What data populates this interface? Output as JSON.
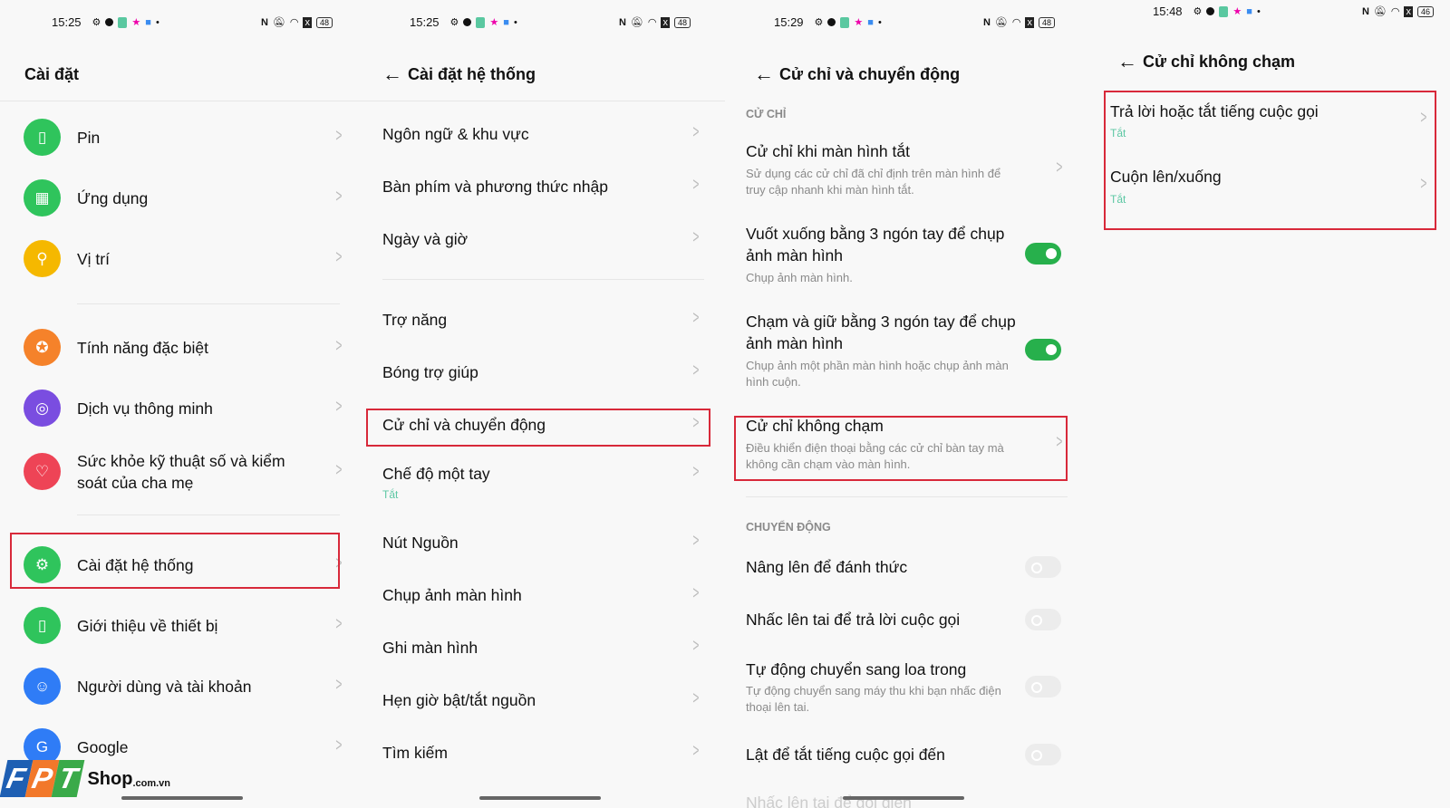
{
  "panels": [
    {
      "status": {
        "time": "15:25",
        "battery": "48"
      },
      "title": "Cài đặt",
      "items": [
        {
          "label": "Pin",
          "icon": "battery-icon",
          "color": "#2fc45c",
          "glyph": "▯"
        },
        {
          "label": "Ứng dụng",
          "icon": "apps-icon",
          "color": "#2fc45c",
          "glyph": "▦"
        },
        {
          "label": "Vị trí",
          "icon": "location-icon",
          "color": "#f5b800",
          "glyph": "⚲"
        },
        {
          "label": "Tính năng đặc biệt",
          "icon": "star-icon",
          "color": "#f5822a",
          "glyph": "✪"
        },
        {
          "label": "Dịch vụ thông minh",
          "icon": "smart-service-icon",
          "color": "#7a4de0",
          "glyph": "◎"
        },
        {
          "label": "Sức khỏe kỹ thuật số và kiểm soát của cha mẹ",
          "icon": "wellbeing-icon",
          "color": "#ee4456",
          "glyph": "♡"
        },
        {
          "label": "Cài đặt hệ thống",
          "icon": "system-settings-icon",
          "color": "#2fc45c",
          "glyph": "⚙"
        },
        {
          "label": "Giới thiệu về thiết bị",
          "icon": "phone-icon",
          "color": "#2fc45c",
          "glyph": "▯"
        },
        {
          "label": "Người dùng và tài khoản",
          "icon": "user-icon",
          "color": "#2f7cf6",
          "glyph": "☺"
        },
        {
          "label": "Google",
          "icon": "google-icon",
          "color": "#2f7cf6",
          "glyph": "G"
        }
      ]
    },
    {
      "status": {
        "time": "15:25",
        "battery": "48"
      },
      "title": "Cài đặt hệ thống",
      "items": [
        {
          "label": "Ngôn ngữ & khu vực"
        },
        {
          "label": "Bàn phím và phương thức nhập"
        },
        {
          "label": "Ngày và giờ"
        },
        {
          "label": "Trợ năng"
        },
        {
          "label": "Bóng trợ giúp"
        },
        {
          "label": "Cử chỉ và chuyển động"
        },
        {
          "label": "Chế độ một tay",
          "value": "Tắt"
        },
        {
          "label": "Nút Nguồn"
        },
        {
          "label": "Chụp ảnh màn hình"
        },
        {
          "label": "Ghi màn hình"
        },
        {
          "label": "Hẹn giờ bật/tắt nguồn"
        },
        {
          "label": "Tìm kiếm"
        }
      ]
    },
    {
      "status": {
        "time": "15:29",
        "battery": "48"
      },
      "title": "Cử chỉ và chuyển động",
      "section_gestures": "CỬ CHỈ",
      "section_motion": "CHUYỂN ĐỘNG",
      "items": [
        {
          "label": "Cử chỉ khi màn hình tắt",
          "desc": "Sử dụng các cử chỉ đã chỉ định trên màn hình để truy cập nhanh khi màn hình tắt."
        },
        {
          "label": "Vuốt xuống bằng 3 ngón tay để chụp ảnh màn hình",
          "desc": "Chụp ảnh màn hình.",
          "toggle": true
        },
        {
          "label": "Chạm và giữ bằng 3 ngón tay để chụp ảnh màn hình",
          "desc": "Chụp ảnh một phần màn hình hoặc chụp ảnh màn hình cuộn.",
          "toggle": true
        },
        {
          "label": "Cử chỉ không chạm",
          "desc": "Điều khiển điện thoại bằng các cử chỉ bàn tay mà không cần chạm vào màn hình."
        },
        {
          "label": "Nâng lên để đánh thức",
          "toggle": false
        },
        {
          "label": "Nhấc lên tai để trả lời cuộc gọi",
          "toggle": false
        },
        {
          "label": "Tự động chuyển sang loa trong",
          "desc": "Tự động chuyển sang máy thu khi bạn nhấc điện thoại lên tai.",
          "toggle": false
        },
        {
          "label": "Lật để tắt tiếng cuộc gọi đến",
          "toggle": false
        },
        {
          "label": "Nhấc lên tai để gọi điện"
        }
      ]
    },
    {
      "status": {
        "time": "15:48",
        "battery": "46"
      },
      "title": "Cử chỉ không chạm",
      "items": [
        {
          "label": "Trả lời hoặc tắt tiếng cuộc gọi",
          "value": "Tắt"
        },
        {
          "label": "Cuộn lên/xuống",
          "value": "Tắt"
        }
      ]
    }
  ],
  "watermark": {
    "brand": "FPT",
    "text": "Shop",
    "domain": ".com.vn"
  }
}
